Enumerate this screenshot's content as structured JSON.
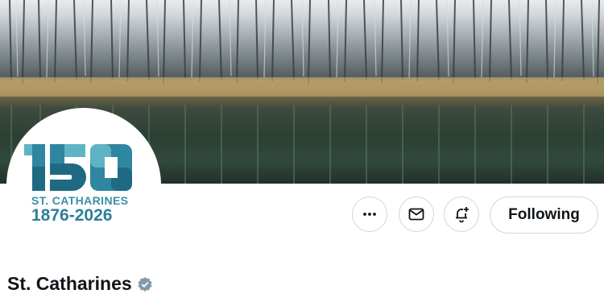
{
  "profile": {
    "display_name": "St. Catharines",
    "verified_badge": "gray-verified-badge-icon",
    "avatar": {
      "logo_number": "150",
      "city_text": "ST. CATHARINES",
      "years_text": "1876-2026",
      "colors": {
        "teal": "#2f86a0",
        "light_teal": "#5fb3c4",
        "dark_teal": "#1f6a82"
      }
    }
  },
  "banner": {
    "scene": "forest-lake-reflection"
  },
  "actions": {
    "more_icon": "more-horizontal-icon",
    "message_icon": "envelope-icon",
    "notify_icon": "bell-plus-icon",
    "follow_label": "Following"
  },
  "colors": {
    "text": "#0f1419",
    "border": "#cfd9de",
    "badge": "#829aab"
  }
}
